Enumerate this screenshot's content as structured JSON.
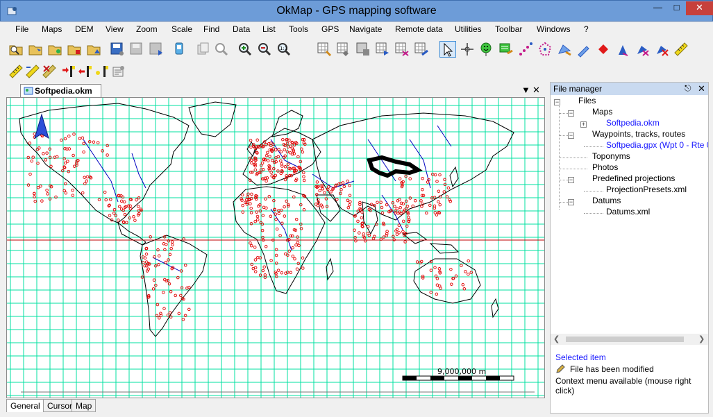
{
  "window": {
    "title": "OkMap - GPS mapping software"
  },
  "menu": [
    "File",
    "Maps",
    "DEM",
    "View",
    "Zoom",
    "Scale",
    "Find",
    "Data",
    "List",
    "Tools",
    "GPS",
    "Navigate",
    "Remote data",
    "Utilities",
    "Toolbar",
    "Windows",
    "?"
  ],
  "document": {
    "tab_label": "Softpedia.okm",
    "scale_label": "9,000,000 m"
  },
  "bottom_tabs": [
    "General",
    "Cursor",
    "Map"
  ],
  "file_manager": {
    "title": "File manager",
    "tree": [
      {
        "label": "Files",
        "link": false
      },
      {
        "label": "Maps",
        "link": false
      },
      {
        "label": "Softpedia.okm",
        "link": true
      },
      {
        "label": "Waypoints, tracks, routes",
        "link": false
      },
      {
        "label": "Softpedia.gpx (Wpt 0 - Rte 0 - T",
        "link": true
      },
      {
        "label": "Toponyms",
        "link": false
      },
      {
        "label": "Photos",
        "link": false
      },
      {
        "label": "Predefined projections",
        "link": false
      },
      {
        "label": "ProjectionPresets.xml",
        "link": false
      },
      {
        "label": "Datums",
        "link": false
      },
      {
        "label": "Datums.xml",
        "link": false
      }
    ],
    "selected_item": {
      "title": "Selected item",
      "status": "File has been modified",
      "hint": "Context menu available (mouse right click)"
    }
  },
  "colors": {
    "title_bar": "#6d9cd8",
    "grid": "#00e0a0",
    "equator": "#c00000",
    "waypoints": "#e00000",
    "rivers": "#0000c0",
    "link_text": "#1a1aff"
  }
}
